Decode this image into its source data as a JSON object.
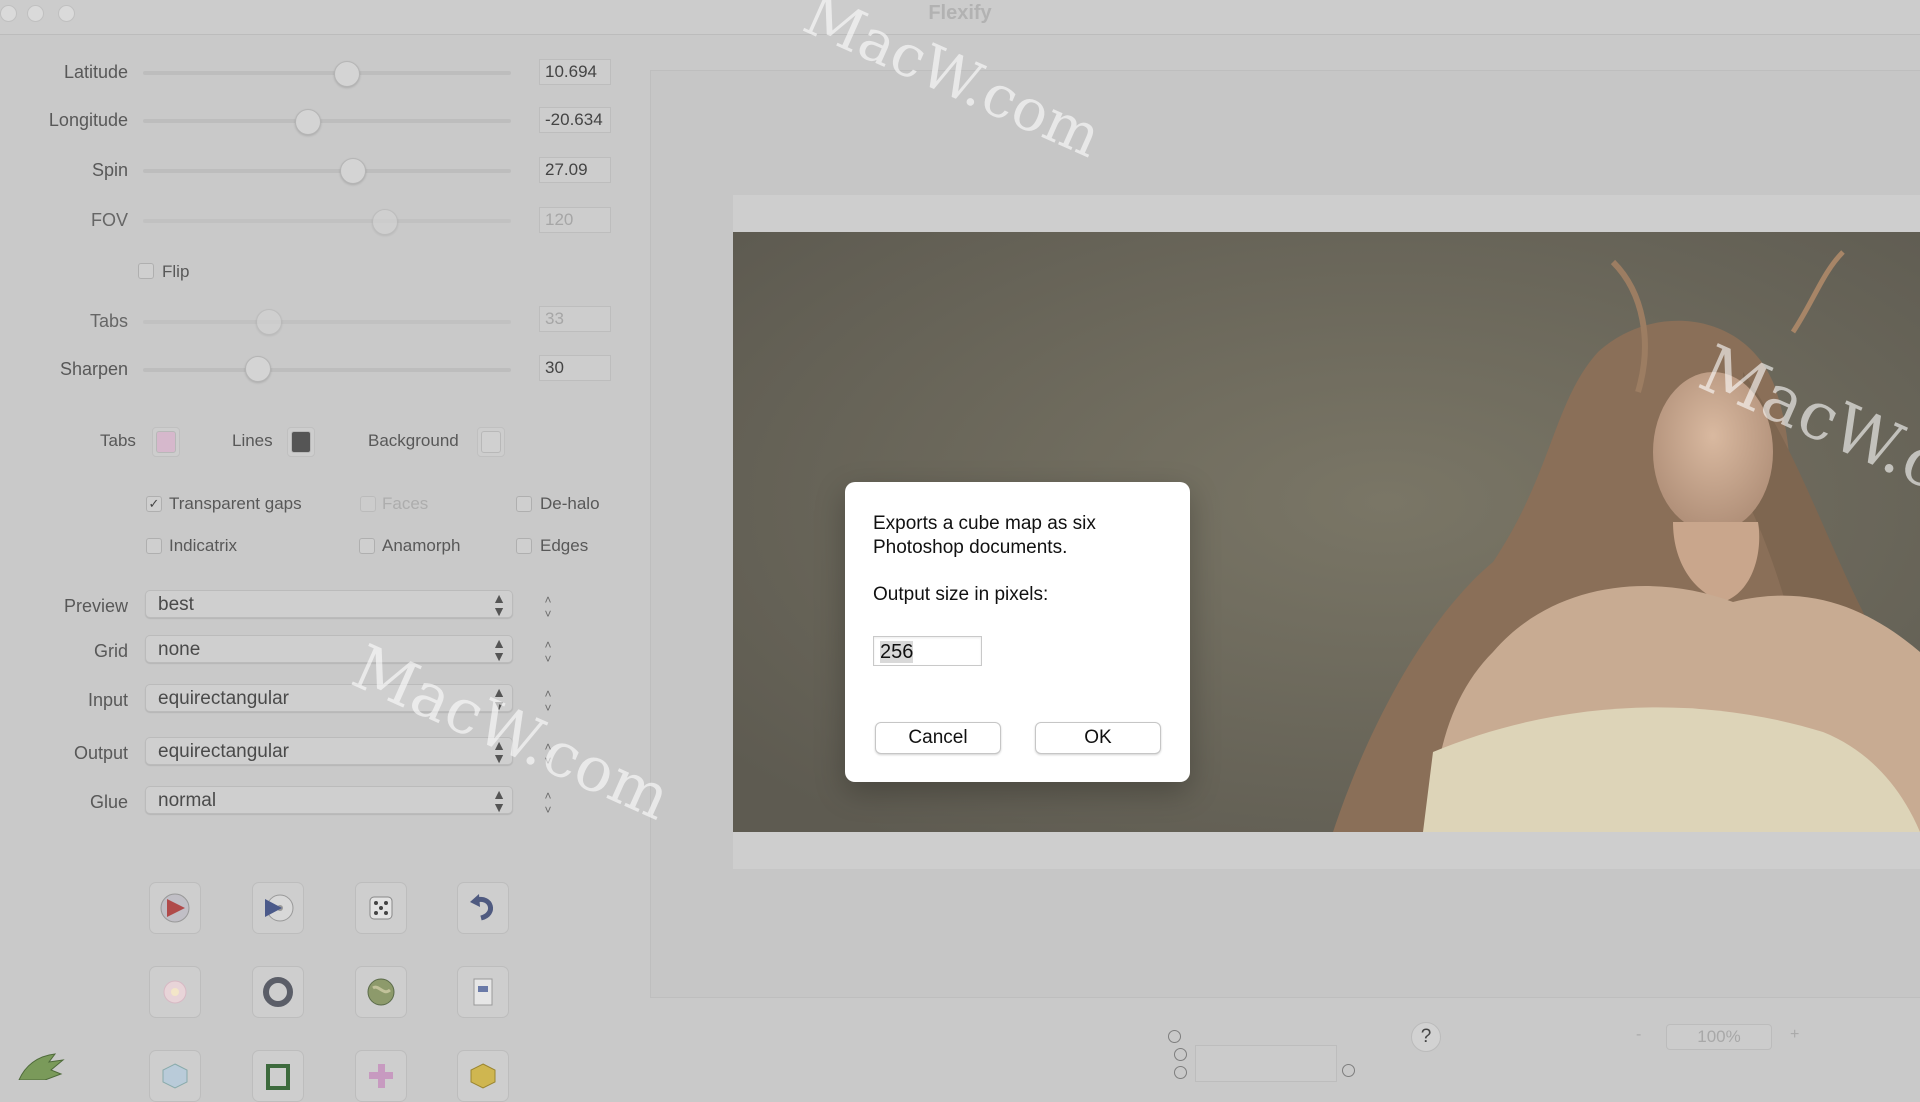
{
  "window": {
    "title": "Flexify"
  },
  "sliders": [
    {
      "label": "Latitude",
      "value": "10.694",
      "fraction": 0.56,
      "enabled": true
    },
    {
      "label": "Longitude",
      "value": "-20.634",
      "fraction": 0.44,
      "enabled": true
    },
    {
      "label": "Spin",
      "value": "27.09",
      "fraction": 0.57,
      "enabled": true
    },
    {
      "label": "FOV",
      "value": "120",
      "fraction": 0.66,
      "enabled": false
    },
    {
      "label": "Tabs",
      "value": "33",
      "fraction": 0.34,
      "enabled": false
    },
    {
      "label": "Sharpen",
      "value": "30",
      "fraction": 0.31,
      "enabled": true
    }
  ],
  "flip": {
    "label": "Flip",
    "checked": false
  },
  "colors": {
    "tabs_label": "Tabs",
    "tabs_color": "#d6b8cc",
    "lines_label": "Lines",
    "lines_color": "#555555",
    "background_label": "Background",
    "background_color": "#d0d0d0"
  },
  "options": {
    "transparent_gaps": {
      "label": "Transparent gaps",
      "checked": true
    },
    "faces": {
      "label": "Faces",
      "checked": false
    },
    "de_halo": {
      "label": "De-halo",
      "checked": false
    },
    "indicatrix": {
      "label": "Indicatrix",
      "checked": false
    },
    "anamorph": {
      "label": "Anamorph",
      "checked": false
    },
    "edges": {
      "label": "Edges",
      "checked": false
    }
  },
  "selects": [
    {
      "label": "Preview",
      "value": "best"
    },
    {
      "label": "Grid",
      "value": "none"
    },
    {
      "label": "Input",
      "value": "equirectangular"
    },
    {
      "label": "Output",
      "value": "equirectangular"
    },
    {
      "label": "Glue",
      "value": "normal"
    }
  ],
  "dialog": {
    "message": "Exports a cube map as six Photoshop documents.",
    "prompt": "Output size in pixels:",
    "input_value": "256",
    "cancel_label": "Cancel",
    "ok_label": "OK"
  },
  "zoom": {
    "value": "100%",
    "minus": "-",
    "plus": "+"
  },
  "help": {
    "label": "?"
  },
  "watermark": {
    "text": "MacW.com"
  }
}
